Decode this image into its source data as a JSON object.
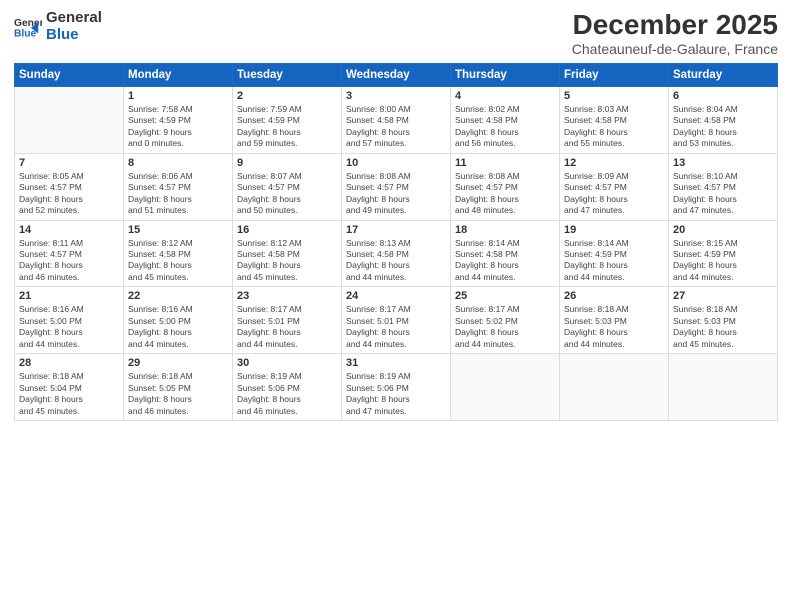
{
  "logo": {
    "general": "General",
    "blue": "Blue"
  },
  "title": "December 2025",
  "subtitle": "Chateauneuf-de-Galaure, France",
  "headers": [
    "Sunday",
    "Monday",
    "Tuesday",
    "Wednesday",
    "Thursday",
    "Friday",
    "Saturday"
  ],
  "weeks": [
    [
      {
        "day": "",
        "info": ""
      },
      {
        "day": "1",
        "info": "Sunrise: 7:58 AM\nSunset: 4:59 PM\nDaylight: 9 hours\nand 0 minutes."
      },
      {
        "day": "2",
        "info": "Sunrise: 7:59 AM\nSunset: 4:59 PM\nDaylight: 8 hours\nand 59 minutes."
      },
      {
        "day": "3",
        "info": "Sunrise: 8:00 AM\nSunset: 4:58 PM\nDaylight: 8 hours\nand 57 minutes."
      },
      {
        "day": "4",
        "info": "Sunrise: 8:02 AM\nSunset: 4:58 PM\nDaylight: 8 hours\nand 56 minutes."
      },
      {
        "day": "5",
        "info": "Sunrise: 8:03 AM\nSunset: 4:58 PM\nDaylight: 8 hours\nand 55 minutes."
      },
      {
        "day": "6",
        "info": "Sunrise: 8:04 AM\nSunset: 4:58 PM\nDaylight: 8 hours\nand 53 minutes."
      }
    ],
    [
      {
        "day": "7",
        "info": "Sunrise: 8:05 AM\nSunset: 4:57 PM\nDaylight: 8 hours\nand 52 minutes."
      },
      {
        "day": "8",
        "info": "Sunrise: 8:06 AM\nSunset: 4:57 PM\nDaylight: 8 hours\nand 51 minutes."
      },
      {
        "day": "9",
        "info": "Sunrise: 8:07 AM\nSunset: 4:57 PM\nDaylight: 8 hours\nand 50 minutes."
      },
      {
        "day": "10",
        "info": "Sunrise: 8:08 AM\nSunset: 4:57 PM\nDaylight: 8 hours\nand 49 minutes."
      },
      {
        "day": "11",
        "info": "Sunrise: 8:08 AM\nSunset: 4:57 PM\nDaylight: 8 hours\nand 48 minutes."
      },
      {
        "day": "12",
        "info": "Sunrise: 8:09 AM\nSunset: 4:57 PM\nDaylight: 8 hours\nand 47 minutes."
      },
      {
        "day": "13",
        "info": "Sunrise: 8:10 AM\nSunset: 4:57 PM\nDaylight: 8 hours\nand 47 minutes."
      }
    ],
    [
      {
        "day": "14",
        "info": "Sunrise: 8:11 AM\nSunset: 4:57 PM\nDaylight: 8 hours\nand 46 minutes."
      },
      {
        "day": "15",
        "info": "Sunrise: 8:12 AM\nSunset: 4:58 PM\nDaylight: 8 hours\nand 45 minutes."
      },
      {
        "day": "16",
        "info": "Sunrise: 8:12 AM\nSunset: 4:58 PM\nDaylight: 8 hours\nand 45 minutes."
      },
      {
        "day": "17",
        "info": "Sunrise: 8:13 AM\nSunset: 4:58 PM\nDaylight: 8 hours\nand 44 minutes."
      },
      {
        "day": "18",
        "info": "Sunrise: 8:14 AM\nSunset: 4:58 PM\nDaylight: 8 hours\nand 44 minutes."
      },
      {
        "day": "19",
        "info": "Sunrise: 8:14 AM\nSunset: 4:59 PM\nDaylight: 8 hours\nand 44 minutes."
      },
      {
        "day": "20",
        "info": "Sunrise: 8:15 AM\nSunset: 4:59 PM\nDaylight: 8 hours\nand 44 minutes."
      }
    ],
    [
      {
        "day": "21",
        "info": "Sunrise: 8:16 AM\nSunset: 5:00 PM\nDaylight: 8 hours\nand 44 minutes."
      },
      {
        "day": "22",
        "info": "Sunrise: 8:16 AM\nSunset: 5:00 PM\nDaylight: 8 hours\nand 44 minutes."
      },
      {
        "day": "23",
        "info": "Sunrise: 8:17 AM\nSunset: 5:01 PM\nDaylight: 8 hours\nand 44 minutes."
      },
      {
        "day": "24",
        "info": "Sunrise: 8:17 AM\nSunset: 5:01 PM\nDaylight: 8 hours\nand 44 minutes."
      },
      {
        "day": "25",
        "info": "Sunrise: 8:17 AM\nSunset: 5:02 PM\nDaylight: 8 hours\nand 44 minutes."
      },
      {
        "day": "26",
        "info": "Sunrise: 8:18 AM\nSunset: 5:03 PM\nDaylight: 8 hours\nand 44 minutes."
      },
      {
        "day": "27",
        "info": "Sunrise: 8:18 AM\nSunset: 5:03 PM\nDaylight: 8 hours\nand 45 minutes."
      }
    ],
    [
      {
        "day": "28",
        "info": "Sunrise: 8:18 AM\nSunset: 5:04 PM\nDaylight: 8 hours\nand 45 minutes."
      },
      {
        "day": "29",
        "info": "Sunrise: 8:18 AM\nSunset: 5:05 PM\nDaylight: 8 hours\nand 46 minutes."
      },
      {
        "day": "30",
        "info": "Sunrise: 8:19 AM\nSunset: 5:06 PM\nDaylight: 8 hours\nand 46 minutes."
      },
      {
        "day": "31",
        "info": "Sunrise: 8:19 AM\nSunset: 5:06 PM\nDaylight: 8 hours\nand 47 minutes."
      },
      {
        "day": "",
        "info": ""
      },
      {
        "day": "",
        "info": ""
      },
      {
        "day": "",
        "info": ""
      }
    ]
  ]
}
